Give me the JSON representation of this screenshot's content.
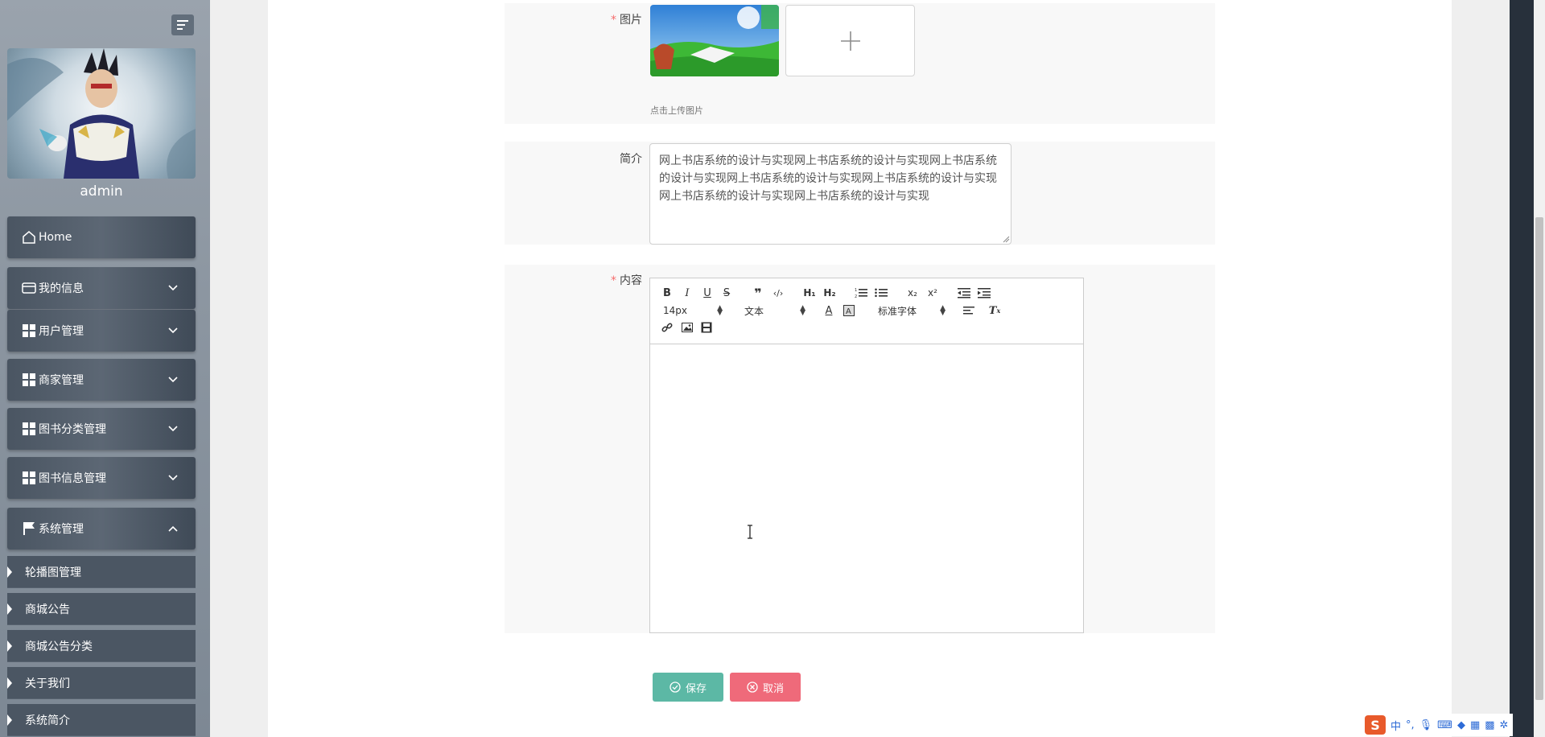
{
  "user": {
    "name": "admin"
  },
  "nav": {
    "items": [
      {
        "label": "Home",
        "icon": "home-icon"
      },
      {
        "label": "我的信息",
        "icon": "wallet-icon"
      },
      {
        "label": "用户管理",
        "icon": "grid-icon"
      },
      {
        "label": "商家管理",
        "icon": "grid-icon"
      },
      {
        "label": "图书分类管理",
        "icon": "grid-icon"
      },
      {
        "label": "图书信息管理",
        "icon": "grid-icon"
      },
      {
        "label": "系统管理",
        "icon": "flag-icon"
      }
    ],
    "sub_items": [
      {
        "label": "轮播图管理"
      },
      {
        "label": "商城公告"
      },
      {
        "label": "商城公告分类"
      },
      {
        "label": "关于我们"
      },
      {
        "label": "系统简介"
      }
    ]
  },
  "form": {
    "image_label": "图片",
    "upload_hint": "点击上传图片",
    "intro_label": "简介",
    "intro_value": "网上书店系统的设计与实现网上书店系统的设计与实现网上书店系统的设计与实现网上书店系统的设计与实现网上书店系统的设计与实现网上书店系统的设计与实现网上书店系统的设计与实现",
    "content_label": "内容",
    "editor": {
      "font_size": "14px",
      "header_select": "文本",
      "font_family": "标准字体"
    },
    "save_label": "保存",
    "cancel_label": "取消"
  },
  "ime": {
    "logo": "S",
    "mode": "中"
  },
  "colors": {
    "save": "#5cb8a5",
    "cancel": "#ef6a7a",
    "required": "#f56c6c",
    "nav_bg": "#4a5562"
  }
}
